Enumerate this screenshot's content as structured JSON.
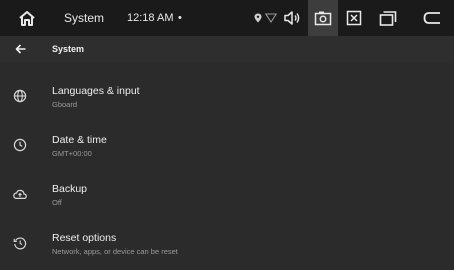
{
  "status_bar": {
    "app_title": "System",
    "time": "12:18 AM",
    "dot": "•",
    "icons": [
      "home-icon",
      "location-icon",
      "wifi-icon",
      "volume-icon",
      "screenshot-icon",
      "close-box-icon",
      "recents-icon",
      "back-arrow-icon"
    ]
  },
  "app_bar": {
    "title": "System",
    "back_icon": "arrow-left-icon"
  },
  "items": [
    {
      "title": "Languages & input",
      "subtitle": "Gboard",
      "icon": "globe-icon"
    },
    {
      "title": "Date & time",
      "subtitle": "GMT+00:00",
      "icon": "clock-icon"
    },
    {
      "title": "Backup",
      "subtitle": "Off",
      "icon": "cloud-upload-icon"
    },
    {
      "title": "Reset options",
      "subtitle": "Network, apps, or device can be reset",
      "icon": "history-icon"
    }
  ],
  "colors": {
    "background": "#2b2b2b",
    "status_bar": "#1a1a1a",
    "active_button": "#3d3d3d"
  }
}
